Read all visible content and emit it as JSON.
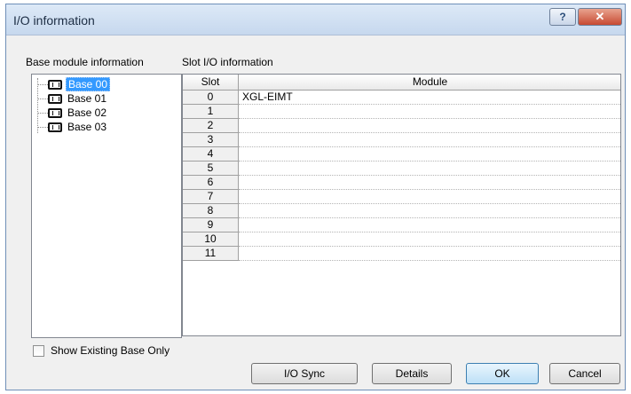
{
  "window": {
    "title": "I/O information"
  },
  "base_panel": {
    "label": "Base module information",
    "items": [
      {
        "label": "Base 00",
        "selected": true
      },
      {
        "label": "Base 01",
        "selected": false
      },
      {
        "label": "Base 02",
        "selected": false
      },
      {
        "label": "Base 03",
        "selected": false
      }
    ],
    "show_existing_label": "Show Existing Base Only",
    "show_existing_checked": false
  },
  "slot_panel": {
    "label": "Slot I/O information",
    "columns": [
      "Slot",
      "Module"
    ],
    "rows": [
      {
        "slot": "0",
        "module": "XGL-EIMT"
      },
      {
        "slot": "1",
        "module": ""
      },
      {
        "slot": "2",
        "module": ""
      },
      {
        "slot": "3",
        "module": ""
      },
      {
        "slot": "4",
        "module": ""
      },
      {
        "slot": "5",
        "module": ""
      },
      {
        "slot": "6",
        "module": ""
      },
      {
        "slot": "7",
        "module": ""
      },
      {
        "slot": "8",
        "module": ""
      },
      {
        "slot": "9",
        "module": ""
      },
      {
        "slot": "10",
        "module": ""
      },
      {
        "slot": "11",
        "module": ""
      }
    ]
  },
  "buttons": {
    "io_sync": "I/O Sync",
    "details": "Details",
    "ok": "OK",
    "cancel": "Cancel"
  },
  "icons": {
    "help": "help-icon",
    "close": "close-icon",
    "base": "base-module-icon"
  },
  "colors": {
    "selection": "#3399ff",
    "close_button": "#c74a32",
    "title_bar": "#c6d8ee"
  }
}
